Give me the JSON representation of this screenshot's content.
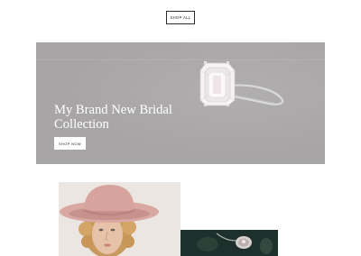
{
  "top": {
    "shop_all_label": "SHOP ALL"
  },
  "hero": {
    "title": "My Brand New Bridal Collection",
    "cta_label": "SHOP NOW"
  },
  "colors": {
    "hero_bg": "#a8a5a6",
    "hero_text": "#ffffff",
    "button_border": "#2b2b2b"
  },
  "icons": {
    "hero_image": "diamond-ring",
    "grid_image_1": "woman-pink-hat",
    "grid_image_2": "jewelry-closeup"
  }
}
